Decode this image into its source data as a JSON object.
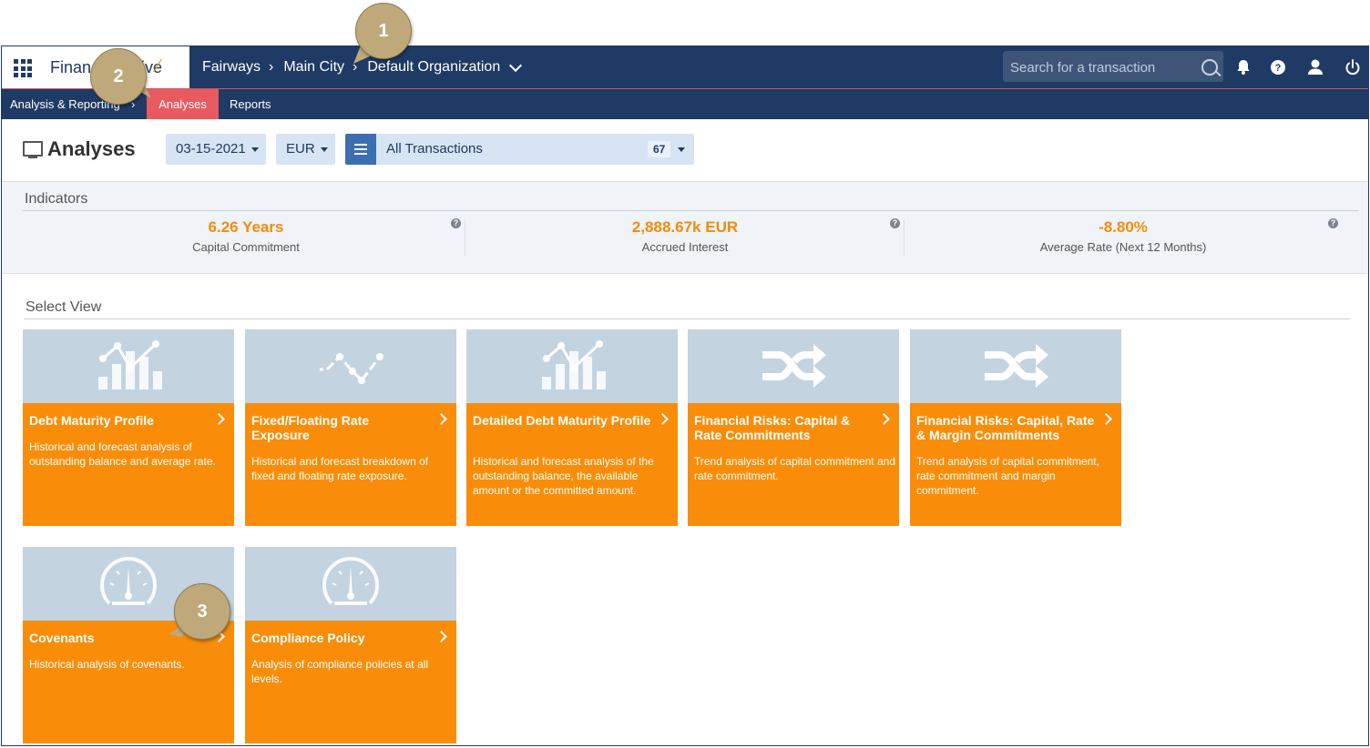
{
  "topbar": {
    "app_name": "FinanceActive",
    "app_name_visible": "Finan",
    "app_name_tail": "ive",
    "breadcrumbs": [
      "Fairways",
      "Main City",
      "Default Organization"
    ],
    "search_placeholder": "Search for a transaction",
    "icons": [
      "bell-icon",
      "help-icon",
      "user-icon",
      "power-icon"
    ]
  },
  "subnav": {
    "section": "Analysis & Reporting",
    "tabs": [
      {
        "label": "Analyses",
        "active": true
      },
      {
        "label": "Reports",
        "active": false
      }
    ]
  },
  "header": {
    "title": "Analyses",
    "date": "03-15-2021",
    "currency": "EUR",
    "filter": "All Transactions",
    "filter_count": "67"
  },
  "indicators": {
    "title": "Indicators",
    "items": [
      {
        "value": "6.26 Years",
        "label": "Capital Commitment"
      },
      {
        "value": "2,888.67k EUR",
        "label": "Accrued Interest"
      },
      {
        "value": "-8.80%",
        "label": "Average Rate (Next 12 Months)"
      }
    ],
    "help": "?"
  },
  "select_view": {
    "title": "Select View",
    "cards": [
      {
        "title": "Debt Maturity Profile",
        "desc": "Historical and forecast analysis of outstanding balance and average rate.",
        "icon": "bar-line-chart-icon"
      },
      {
        "title": "Fixed/Floating Rate Exposure",
        "desc": "Historical and forecast breakdown of fixed and floating rate exposure.",
        "icon": "line-chart-icon"
      },
      {
        "title": "Detailed Debt Maturity Profile",
        "desc": "Historical and forecast analysis of the outstanding balance, the available amount or the committed amount.",
        "icon": "bar-line-chart-icon"
      },
      {
        "title": "Financial Risks: Capital & Rate Commitments",
        "desc": "Trend analysis of capital commitment and rate commitment.",
        "icon": "shuffle-icon"
      },
      {
        "title": "Financial Risks: Capital, Rate & Margin Commitments",
        "desc": "Trend analysis of capital commitment, rate commitment and margin commitment.",
        "icon": "shuffle-icon"
      },
      {
        "title": "Covenants",
        "desc": "Historical analysis of covenants.",
        "icon": "gauge-icon"
      },
      {
        "title": "Compliance Policy",
        "desc": "Analysis of compliance policies at all levels.",
        "icon": "gauge-icon"
      }
    ]
  },
  "callouts": [
    "1",
    "2",
    "3"
  ],
  "colors": {
    "navy": "#1f3a64",
    "accent": "#f98d0a",
    "active_tab": "#e85a60",
    "card_image": "#c3d3e0"
  }
}
